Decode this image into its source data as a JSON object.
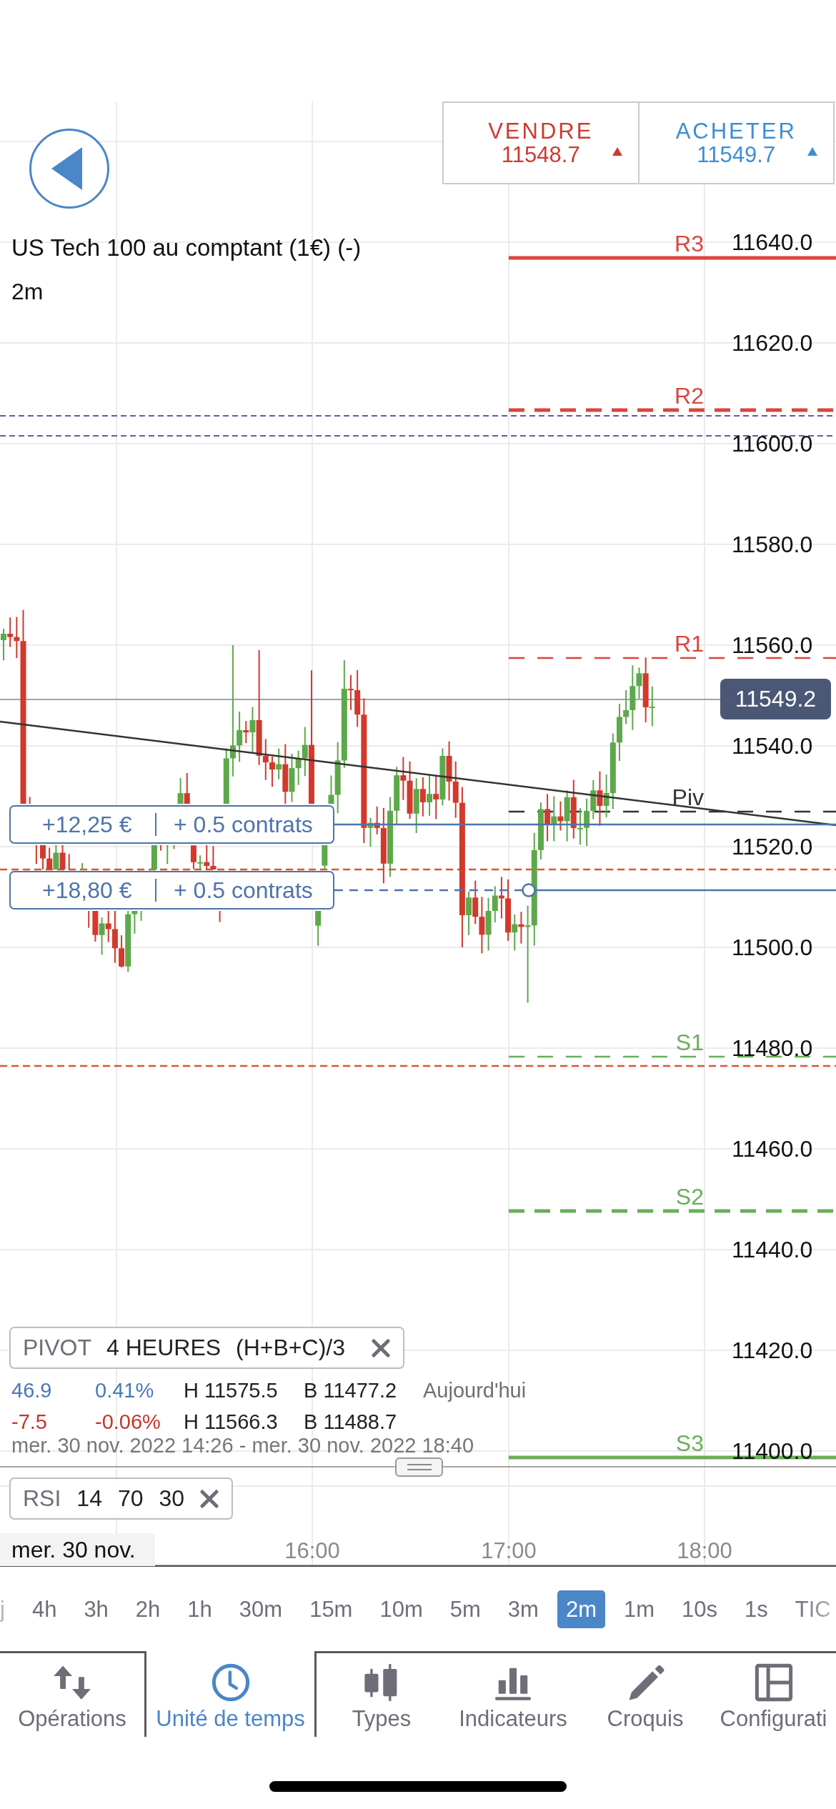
{
  "quote": {
    "sell": {
      "label": "VENDRE",
      "price": "11548.7"
    },
    "buy": {
      "label": "ACHETER",
      "price": "11549.7"
    }
  },
  "instrument": {
    "name": "US Tech 100 au comptant (1€) (-)",
    "timeframe": "2m"
  },
  "price_axis": [
    "11640.0",
    "11620.0",
    "11600.0",
    "11580.0",
    "11560.0",
    "11540.0",
    "11520.0",
    "11500.0",
    "11480.0",
    "11460.0",
    "11440.0",
    "11420.0",
    "11400.0"
  ],
  "current_price": "11549.2",
  "pivot_levels": [
    {
      "label": "R3",
      "color": "#d9463e",
      "kind": "solid"
    },
    {
      "label": "R2",
      "color": "#d9463e",
      "kind": "bold-dashed"
    },
    {
      "label": "R1",
      "color": "#d9463e",
      "kind": "dashed"
    },
    {
      "label": "Piv",
      "color": "#333333",
      "kind": "dashed"
    },
    {
      "label": "S1",
      "color": "#6aae5a",
      "kind": "dashed"
    },
    {
      "label": "S2",
      "color": "#6aae5a",
      "kind": "bold-dashed"
    },
    {
      "label": "S3",
      "color": "#6aae5a",
      "kind": "solid"
    }
  ],
  "positions": [
    {
      "pnl": "+12,25 €",
      "size": "+ 0.5 contrats",
      "kind": "solid"
    },
    {
      "pnl": "+18,80 €",
      "size": "+ 0.5 contrats",
      "kind": "dashed"
    }
  ],
  "time_axis": {
    "date": "mer. 30 nov.",
    "ticks": [
      "16:00",
      "17:00",
      "18:00"
    ]
  },
  "pivot_legend": {
    "name": "PIVOT",
    "period": "4 HEURES",
    "formula": "(H+B+C)/3",
    "rows": [
      {
        "change": "46.9",
        "percent": "0.41%",
        "high": "H 11575.5",
        "low": "B 11477.2",
        "note": "Aujourd'hui",
        "color": "#4a78b8"
      },
      {
        "change": "-7.5",
        "percent": "-0.06%",
        "high": "H 11566.3",
        "low": "B 11488.7",
        "color": "#c8352b"
      }
    ],
    "range": "mer. 30 nov. 2022 14:26 - mer. 30 nov. 2022 18:40"
  },
  "rsi_legend": {
    "name": "RSI",
    "params": [
      "14",
      "70",
      "30"
    ]
  },
  "timeframes": [
    {
      "label": "j",
      "selected": false
    },
    {
      "label": "4h",
      "selected": false
    },
    {
      "label": "3h",
      "selected": false
    },
    {
      "label": "2h",
      "selected": false
    },
    {
      "label": "1h",
      "selected": false
    },
    {
      "label": "30m",
      "selected": false
    },
    {
      "label": "15m",
      "selected": false
    },
    {
      "label": "10m",
      "selected": false
    },
    {
      "label": "5m",
      "selected": false
    },
    {
      "label": "3m",
      "selected": false
    },
    {
      "label": "2m",
      "selected": true
    },
    {
      "label": "1m",
      "selected": false
    },
    {
      "label": "10s",
      "selected": false
    },
    {
      "label": "1s",
      "selected": false
    },
    {
      "label": "TIC",
      "selected": false
    }
  ],
  "tabs": [
    {
      "label": "Opérations",
      "kind": "arrows",
      "selected": false
    },
    {
      "label": "Unité de temps",
      "kind": "clock",
      "selected": true
    },
    {
      "label": "Types",
      "kind": "candles",
      "selected": false
    },
    {
      "label": "Indicateurs",
      "kind": "bars",
      "selected": false
    },
    {
      "label": "Croquis",
      "kind": "pencil",
      "selected": false
    },
    {
      "label": "Configurati",
      "kind": "layout",
      "selected": false
    }
  ]
}
